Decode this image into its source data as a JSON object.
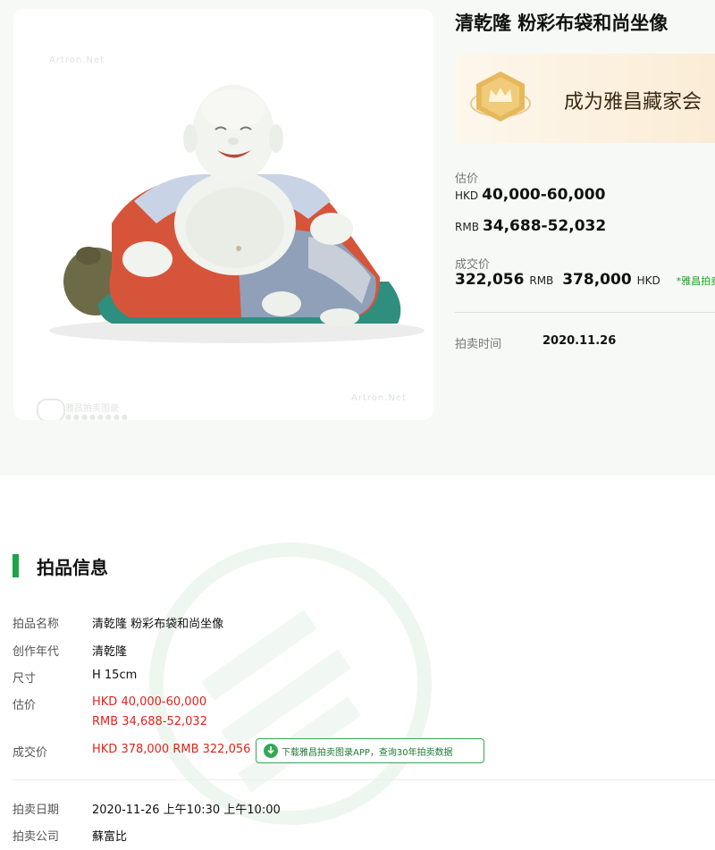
{
  "lot": {
    "title": "清乾隆 粉彩布袋和尚坐像",
    "image_alt": "porcelain-budai-figure",
    "watermark": "Artron.Net",
    "watermark_company": "雅昌拍卖图录",
    "watermark_company_sub": "●●●●●●●●"
  },
  "banner": {
    "text": "成为雅昌藏家会"
  },
  "estimate": {
    "label": "估价",
    "hkd_currency": "HKD",
    "hkd_value": "40,000-60,000",
    "rmb_currency": "RMB",
    "rmb_value": "34,688-52,032"
  },
  "hammer": {
    "label": "成交价",
    "rmb_value": "322,056",
    "rmb_currency": "RMB",
    "hkd_value": "378,000",
    "hkd_currency": "HKD",
    "note": "*雅昌拍卖图录"
  },
  "auction_time": {
    "label": "拍卖时间",
    "value": "2020.11.26"
  },
  "info": {
    "section_title": "拍品信息",
    "rows": [
      {
        "label": "拍品名称",
        "value": "清乾隆 粉彩布袋和尚坐像"
      },
      {
        "label": "创作年代",
        "value": "清乾隆"
      },
      {
        "label": "尺寸",
        "value": "H 15cm"
      },
      {
        "label": "估价",
        "value": "HKD 40,000-60,000",
        "value2": "RMB 34,688-52,032"
      },
      {
        "label": "成交价",
        "value": "HKD 378,000 RMB 322,056"
      },
      {
        "label": "拍卖日期",
        "value": "2020-11-26 上午10:30 上午10:00"
      },
      {
        "label": "拍卖公司",
        "value": "蘇富比"
      }
    ],
    "app_button": "下载雅昌拍卖图录APP，查询30年拍卖数据"
  },
  "colors": {
    "accent_green": "#1ea34a",
    "price_red": "#e2231a"
  }
}
